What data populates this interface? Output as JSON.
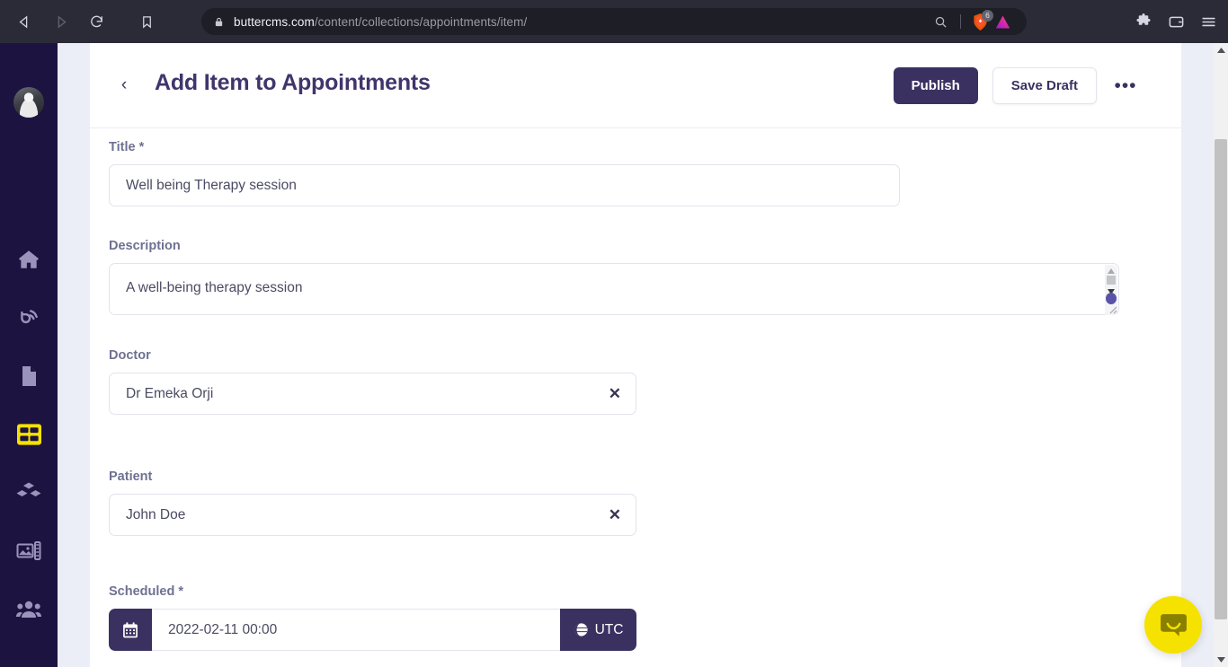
{
  "browser": {
    "back_icon": "back-arrow-icon",
    "forward_icon": "forward-arrow-icon",
    "reload_icon": "reload-icon",
    "bookmark_icon": "bookmark-icon",
    "lock_icon": "lock-icon",
    "url_host": "buttercms.com",
    "url_path": "/content/collections/appointments/item/",
    "zoom_icon": "zoom-search-icon",
    "brave_shield_icon": "brave-lion-icon",
    "brave_badge_count": "6",
    "brave_rewards_icon": "brave-rewards-triangle-icon",
    "extensions_icon": "puzzle-extensions-icon",
    "wallet_icon": "wallet-icon",
    "menu_icon": "hamburger-menu-icon"
  },
  "sidebar": {
    "avatar": "user-avatar",
    "items": [
      {
        "name": "sidebar-item-home",
        "icon": "home-icon",
        "active": false
      },
      {
        "name": "sidebar-item-blog",
        "icon": "blog-rss-icon",
        "active": false
      },
      {
        "name": "sidebar-item-pages",
        "icon": "page-document-icon",
        "active": false
      },
      {
        "name": "sidebar-item-collections",
        "icon": "collections-grid-icon",
        "active": true
      },
      {
        "name": "sidebar-item-components",
        "icon": "components-blocks-icon",
        "active": false
      },
      {
        "name": "sidebar-item-media",
        "icon": "media-image-icon",
        "active": false
      },
      {
        "name": "sidebar-item-users",
        "icon": "users-group-icon",
        "active": false
      }
    ],
    "active_color": "#f5e200",
    "idle_color": "#9a93bb",
    "background": "#1d1340"
  },
  "header": {
    "back_label": "‹",
    "title": "Add Item to Appointments",
    "publish_label": "Publish",
    "save_draft_label": "Save Draft",
    "more_label": "•••",
    "publish_color": "#3b3161"
  },
  "form": {
    "title": {
      "label": "Title",
      "required_mark": "*",
      "value": "Well being Therapy session"
    },
    "description": {
      "label": "Description",
      "value": "A well-being therapy session"
    },
    "doctor": {
      "label": "Doctor",
      "value": "Dr Emeka Orji",
      "clear_label": "✕"
    },
    "patient": {
      "label": "Patient",
      "value": "John Doe",
      "clear_label": "✕"
    },
    "scheduled": {
      "label": "Scheduled",
      "required_mark": "*",
      "value": "2022-02-11 00:00",
      "calendar_icon": "calendar-icon",
      "timezone_icon": "globe-icon",
      "timezone_label": "UTC"
    }
  },
  "intercom": {
    "icon": "chat-bubble-icon",
    "color": "#f5e200"
  },
  "scrollbar": {
    "up_icon": "scroll-up-arrow-icon",
    "down_icon": "scroll-down-arrow-icon"
  }
}
